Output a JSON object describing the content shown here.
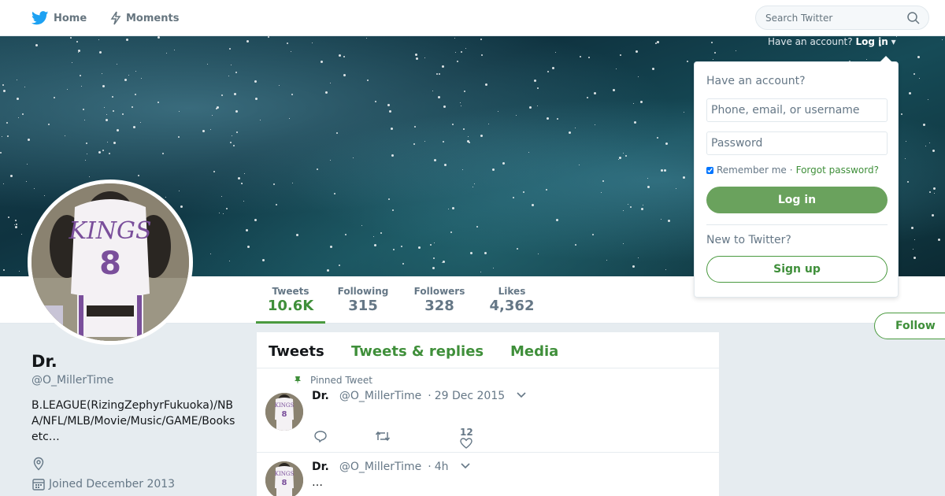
{
  "nav": {
    "home_label": "Home",
    "moments_label": "Moments",
    "search_placeholder": "Search Twitter"
  },
  "login_hint": {
    "prefix": "Have an account?",
    "link": "Log in",
    "caret": "▾"
  },
  "profile_stats": [
    {
      "label": "Tweets",
      "value": "10.6K"
    },
    {
      "label": "Following",
      "value": "315"
    },
    {
      "label": "Followers",
      "value": "328"
    },
    {
      "label": "Likes",
      "value": "4,362"
    }
  ],
  "follow_label": "Follow",
  "profile": {
    "name": "Dr.󠁿󠁿󠁿",
    "handle": "@O_MillerTime",
    "bio": "B.LEAGUE(RizingZephyrFukuoka)/NBA/NFL/MLB/Movie/Music/GAME/Books etc…",
    "joined": "Joined December 2013"
  },
  "timeline": {
    "tabs": [
      "Tweets",
      "Tweets & replies",
      "Media"
    ],
    "pinned_label": "Pinned Tweet",
    "tweets": [
      {
        "name": "Dr.",
        "handle": "@O_MillerTime",
        "sep": "·",
        "time": "29 Dec 2015",
        "text": "",
        "likes": "12"
      },
      {
        "name": "Dr.",
        "handle": "@O_MillerTime",
        "sep": "·",
        "time": "4h",
        "text": "…"
      }
    ]
  },
  "login_panel": {
    "title": "Have an account?",
    "username_placeholder": "Phone, email, or username",
    "password_placeholder": "Password",
    "remember_label": "Remember me",
    "dot": "·",
    "forgot_label": "Forgot password?",
    "login_button": "Log in",
    "new_label": "New to Twitter?",
    "signup_button": "Sign up"
  },
  "colors": {
    "accent": "#3f8f3a",
    "twitter_blue": "#1da1f2"
  }
}
